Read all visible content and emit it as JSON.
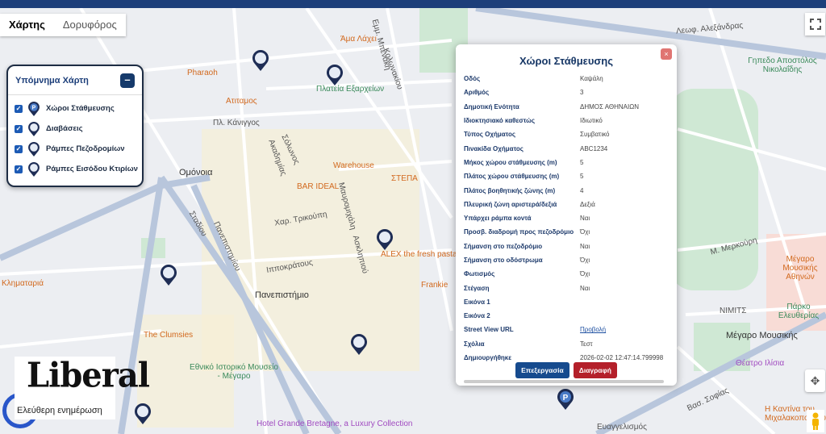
{
  "map_type": {
    "map_label": "Χάρτης",
    "satellite_label": "Δορυφόρος"
  },
  "legend": {
    "title": "Υπόμνημα Χάρτη",
    "toggle_label": "–",
    "items": [
      {
        "label": "Χώροι Στάθμευσης",
        "icon": "parking-pin-icon",
        "checked": true
      },
      {
        "label": "Διαβάσεις",
        "icon": "crosswalk-pin-icon",
        "checked": true
      },
      {
        "label": "Ράμπες Πεζοδρομίων",
        "icon": "wheelchair-pin-icon",
        "checked": true
      },
      {
        "label": "Ράμπες Εισόδου Κτιρίων",
        "icon": "building-ramp-pin-icon",
        "checked": true
      }
    ]
  },
  "popup": {
    "title": "Χώροι Στάθμευσης",
    "close_label": "×",
    "fields": [
      {
        "key": "Οδός",
        "value": "Καψάλη"
      },
      {
        "key": "Αριθμός",
        "value": "3"
      },
      {
        "key": "Δημοτική Ενότητα",
        "value": "ΔΗΜΟΣ ΑΘΗΝΑΙΩΝ"
      },
      {
        "key": "Ιδιοκτησιακό καθεστώς",
        "value": "Ιδιωτικό"
      },
      {
        "key": "Τύπος Οχήματος",
        "value": "Συμβατικό"
      },
      {
        "key": "Πινακίδα Οχήματος",
        "value": "ABC1234"
      },
      {
        "key": "Μήκος χώρου στάθμευσης (m)",
        "value": "5"
      },
      {
        "key": "Πλάτος χώρου στάθμευσης (m)",
        "value": "5"
      },
      {
        "key": "Πλάτος βοηθητικής ζώνης (m)",
        "value": "4"
      },
      {
        "key": "Πλευρική ζώνη αριστερά/δεξιά",
        "value": "Δεξιά"
      },
      {
        "key": "Υπάρχει ράμπα κοντά",
        "value": "Ναι"
      },
      {
        "key": "Προσβ. διαδρομή προς πεζοδρόμιο",
        "value": "Όχι"
      },
      {
        "key": "Σήμανση στο πεζοδρόμιο",
        "value": "Ναι"
      },
      {
        "key": "Σήμανση στο οδόστρωμα",
        "value": "Όχι"
      },
      {
        "key": "Φωτισμός",
        "value": "Όχι"
      },
      {
        "key": "Στέγαση",
        "value": "Ναι"
      },
      {
        "key": "Εικόνα 1",
        "value": ""
      },
      {
        "key": "Εικόνα 2",
        "value": ""
      },
      {
        "key": "Street View URL",
        "value": "Προβολή",
        "link": true
      },
      {
        "key": "Σχόλια",
        "value": "Τεστ"
      },
      {
        "key": "Δημιουργήθηκε",
        "value": "2026-02-02 12:47:14.799998"
      }
    ],
    "edit_label": "Επεξεργασία",
    "delete_label": "Διαγραφή"
  },
  "logo": {
    "word": "Liberal",
    "tagline": "Ελεύθερη ενημέρωση"
  },
  "map": {
    "labels": [
      "Πλατεία Εξαρχείων",
      "Άμα Λάχει",
      "Pharaoh",
      "Ατιταμος",
      "Πλ. Κάνιγγος",
      "Ομόνοια",
      "Warehouse",
      "ΣΤΕΠΑ",
      "BAR IDEAL",
      "ALEX the fresh pasta",
      "Frankie",
      "Πανεπιστήμιο",
      "The Clumsies",
      "Εθνικό Ιστορικό Μουσείο - Μέγαρο",
      "Hotel Grande Bretagne, a Luxury Collection",
      "Γηπεδο Αποστόλος Νικολαΐδης",
      "Μέγαρο Μουσικής Αθηνών",
      "Πάρκο Ελευθερίας",
      "ΝΙΜΙΤΣ",
      "Μέγαρο Μουσικής",
      "Θέατρο Ιλίσια",
      "Η Καντίνα του Μιχαλακοπούλου",
      "Ευαγγελισμός",
      "Κληματαριά",
      "Σταδίου",
      "Πανεπιστημίου",
      "Ακαδημίας",
      "Σόλωνος",
      "Χαρ. Τρικούπη",
      "Λεωφ. Αλεξάνδρας",
      "Ιπποκράτους",
      "Κολωνακίου",
      "Μ. Μερκούρη",
      "Βασ. Σοφίας",
      "Ασκληπιού",
      "Μαυρομιχάλη",
      "Εμμ. Μπενάκη"
    ]
  },
  "colors": {
    "accent": "#1d3f7a",
    "delete": "#b4202a",
    "edit": "#164b8e",
    "road": "#b8c6dc",
    "park": "#cfe8d4",
    "block": "#f6efd6"
  }
}
